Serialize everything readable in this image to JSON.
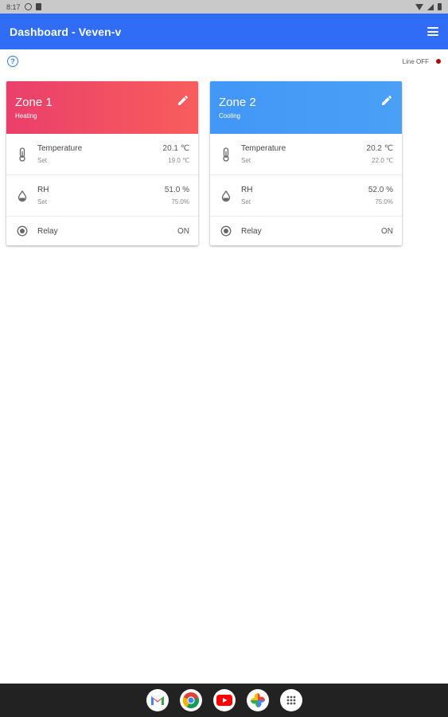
{
  "status_bar": {
    "time": "8:17"
  },
  "app_bar": {
    "title": "Dashboard - Veven-v"
  },
  "sub_bar": {
    "line_status": "Line OFF",
    "line_status_color": "#b00000"
  },
  "zones": [
    {
      "name": "Zone 1",
      "mode": "Heating",
      "accent": "#ea3f6c",
      "rows": {
        "temperature": {
          "label": "Temperature",
          "set_label": "Set",
          "value": "20.1 ℃",
          "set_value": "19.0 ℃"
        },
        "rh": {
          "label": "RH",
          "set_label": "Set",
          "value": "51.0 %",
          "set_value": "75.0%"
        },
        "relay": {
          "label": "Relay",
          "value": "ON"
        }
      }
    },
    {
      "name": "Zone 2",
      "mode": "Cooling",
      "accent": "#4297f7",
      "rows": {
        "temperature": {
          "label": "Temperature",
          "set_label": "Set",
          "value": "20.2 ℃",
          "set_value": "22.0 ℃"
        },
        "rh": {
          "label": "RH",
          "set_label": "Set",
          "value": "52.0 %",
          "set_value": "75.0%"
        },
        "relay": {
          "label": "Relay",
          "value": "ON"
        }
      }
    }
  ],
  "dock": {
    "apps": [
      "gmail-icon",
      "chrome-icon",
      "youtube-icon",
      "photos-icon",
      "app-drawer-icon"
    ]
  }
}
